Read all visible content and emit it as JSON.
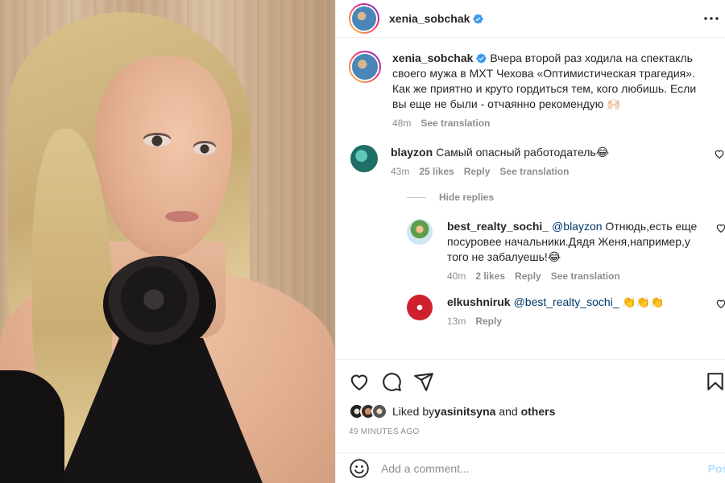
{
  "post": {
    "username": "xenia_sobchak",
    "caption": "Вчера второй раз ходила на спектакль своего мужа в МХТ Чехова «Оптимистическая трагедия». Как же приятно и круто гордиться тем, кого любишь. Если вы еще не были - отчаянно рекомендую 🙌🏻",
    "caption_time": "48m",
    "see_translation": "See translation",
    "icons": {
      "more": "more-options-icon",
      "verified": "verified-badge-icon"
    }
  },
  "comments": [
    {
      "username": "blayzon",
      "text": "Самый опасный работодатель😂",
      "time": "43m",
      "likes": "25 likes",
      "reply": "Reply",
      "see_translation": "See translation",
      "hide_replies": "Hide replies",
      "replies": [
        {
          "username": "best_realty_sochi_",
          "mention": "@blayzon",
          "text": " Отнюдь,есть еще посуровее начальники.Дядя Женя,например,у того не забалуешь!😂",
          "time": "40m",
          "likes": "2 likes",
          "reply": "Reply",
          "see_translation": "See translation"
        },
        {
          "username": "elkushniruk",
          "mention": "@best_realty_sochi_",
          "text": " 👏👏👏",
          "time": "13m",
          "reply": "Reply"
        }
      ]
    }
  ],
  "actions": {
    "icons": [
      "heart-icon",
      "comment-icon",
      "share-icon",
      "bookmark-icon"
    ],
    "liked_by_prefix": "Liked by ",
    "liked_by_user": "yasinitsyna",
    "liked_by_and": " and ",
    "liked_by_others": "others",
    "posted_time": "49 MINUTES AGO"
  },
  "add_comment": {
    "placeholder": "Add a comment...",
    "post_label": "Post"
  },
  "colors": {
    "link": "#00376b",
    "meta": "#8e8e8e",
    "verified": "#3897f0",
    "post_disabled": "#b2dffc"
  }
}
